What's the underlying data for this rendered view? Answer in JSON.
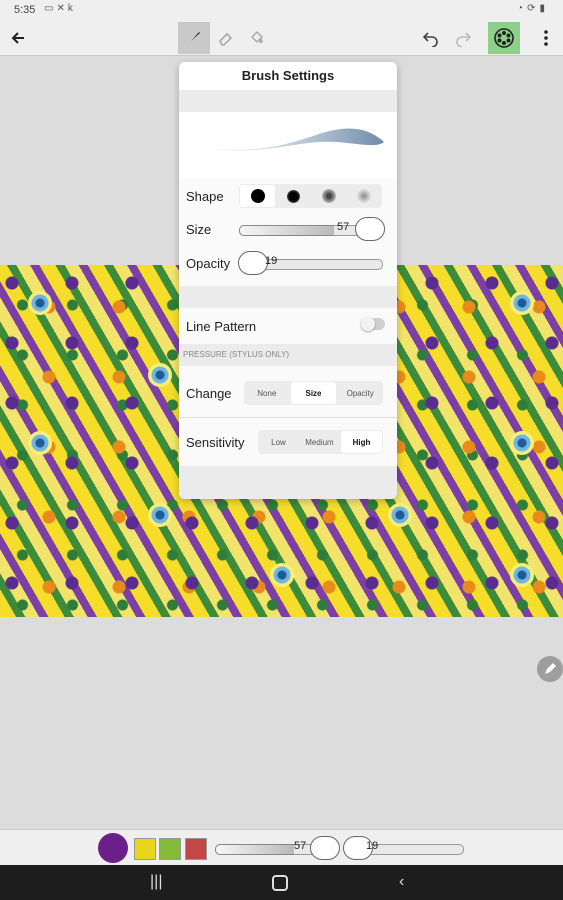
{
  "status_bar": {
    "time": "5:35",
    "left_icons": [
      "image-icon",
      "tools-icon",
      "k-icon"
    ],
    "right_icons": [
      "wifi-icon",
      "sync-icon",
      "battery-icon"
    ]
  },
  "toolbar": {
    "back_icon": "arrow-left-icon",
    "tools": [
      {
        "name": "brush",
        "icon": "brush-icon",
        "selected": true
      },
      {
        "name": "eraser",
        "icon": "eraser-icon",
        "selected": false
      },
      {
        "name": "fill",
        "icon": "bucket-icon",
        "selected": false
      }
    ],
    "undo_icon": "undo-icon",
    "redo_icon": "redo-icon",
    "kaleidoscope_icon": "kaleidoscope-icon",
    "more_icon": "more-vert-icon",
    "accent": "#8ed08a"
  },
  "brush_settings": {
    "title": "Brush Settings",
    "shape_label": "Shape",
    "shapes": [
      "hard",
      "medium",
      "soft",
      "softest"
    ],
    "selected_shape": 0,
    "size_label": "Size",
    "size_value": "57",
    "size_fraction": 0.47,
    "opacity_label": "Opacity",
    "opacity_value": "19",
    "opacity_fraction": 0.19,
    "line_pattern_label": "Line Pattern",
    "line_pattern_on": false,
    "pressure_header": "PRESSURE (STYLUS ONLY)",
    "change_label": "Change",
    "change_options": [
      "None",
      "Size",
      "Opacity"
    ],
    "change_selected": 1,
    "sensitivity_label": "Sensitivity",
    "sensitivity_options": [
      "Low",
      "Medium",
      "High"
    ],
    "sensitivity_selected": 2
  },
  "bottom_bar": {
    "colors": [
      "#6a1f8a",
      "#e8d51c",
      "#86bb3a",
      "#c24848"
    ],
    "size_value": "57",
    "opacity_value": "19"
  },
  "nav_bar": {
    "recent_icon": "recents-icon",
    "home_icon": "home-icon",
    "back_icon": "back-icon"
  },
  "fab_icon": "pencil-icon"
}
